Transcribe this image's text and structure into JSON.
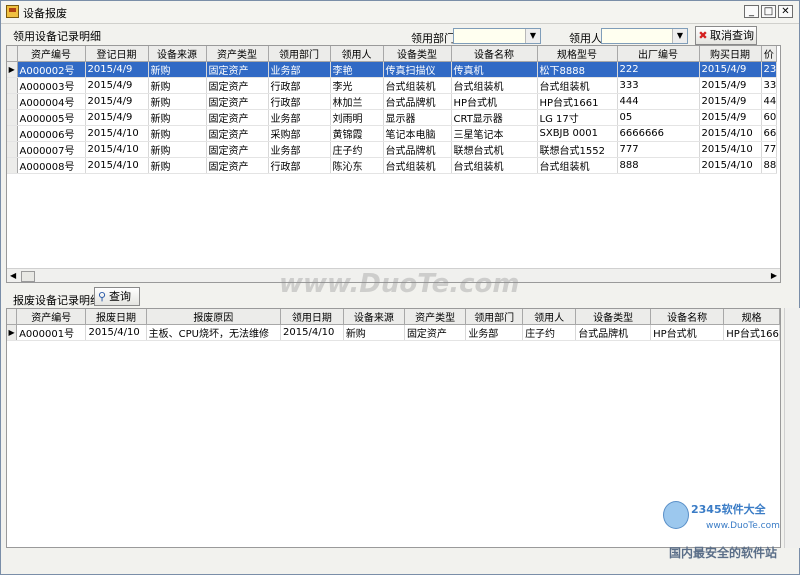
{
  "window": {
    "title": "设备报废"
  },
  "top": {
    "section_label": "领用设备记录明细",
    "dept_label": "领用部门",
    "dept_value": "",
    "user_label": "领用人",
    "user_value": "",
    "cancel_query_label": "取消查询"
  },
  "top_grid": {
    "columns": [
      "资产编号",
      "登记日期",
      "设备来源",
      "资产类型",
      "领用部门",
      "领用人",
      "设备类型",
      "设备名称",
      "规格型号",
      "出厂编号",
      "购买日期",
      "价"
    ],
    "rows": [
      [
        "A000002号",
        "2015/4/9",
        "新购",
        "固定资产",
        "业务部",
        "李艳",
        "传真扫描仪",
        "传真机",
        "松下8888",
        "222",
        "2015/4/9",
        "23"
      ],
      [
        "A000003号",
        "2015/4/9",
        "新购",
        "固定资产",
        "行政部",
        "李光",
        "台式组装机",
        "台式组装机",
        "台式组装机",
        "333",
        "2015/4/9",
        "33"
      ],
      [
        "A000004号",
        "2015/4/9",
        "新购",
        "固定资产",
        "行政部",
        "林加兰",
        "台式品牌机",
        "HP台式机",
        "HP台式1661",
        "444",
        "2015/4/9",
        "44"
      ],
      [
        "A000005号",
        "2015/4/9",
        "新购",
        "固定资产",
        "业务部",
        "刘雨明",
        "显示器",
        "CRT显示器",
        "LG 17寸",
        "05",
        "2015/4/9",
        "60"
      ],
      [
        "A000006号",
        "2015/4/10",
        "新购",
        "固定资产",
        "采购部",
        "黄锦霞",
        "笔记本电脑",
        "三星笔记本",
        "SXBJB 0001",
        "6666666",
        "2015/4/10",
        "66"
      ],
      [
        "A000007号",
        "2015/4/10",
        "新购",
        "固定资产",
        "业务部",
        "庄子约",
        "台式品牌机",
        "联想台式机",
        "联想台式1552",
        "777",
        "2015/4/10",
        "77"
      ],
      [
        "A000008号",
        "2015/4/10",
        "新购",
        "固定资产",
        "行政部",
        "陈沁东",
        "台式组装机",
        "台式组装机",
        "台式组装机",
        "888",
        "2015/4/10",
        "88"
      ]
    ]
  },
  "bottom": {
    "section_label": "报废设备记录明细",
    "query_label": "查询"
  },
  "bottom_grid": {
    "columns": [
      "资产编号",
      "报废日期",
      "报废原因",
      "领用日期",
      "设备来源",
      "资产类型",
      "领用部门",
      "领用人",
      "设备类型",
      "设备名称",
      "规格"
    ],
    "rows": [
      [
        "A000001号",
        "2015/4/10",
        "主板、CPU烧坏，无法维修",
        "2015/4/10",
        "新购",
        "固定资产",
        "业务部",
        "庄子约",
        "台式品牌机",
        "HP台式机",
        "HP台式166"
      ]
    ]
  },
  "watermarks": {
    "duote": "www.DuoTe.com",
    "site_brand": "2345软件大全",
    "site_url": "www.DuoTe.com",
    "slogan": "国内最安全的软件站"
  },
  "icons": {
    "app": "app-icon",
    "minimize": "minimize-icon",
    "maximize": "maximize-icon",
    "close": "close-icon",
    "cancel": "red-x-icon",
    "search": "magnifier-icon",
    "dropdown": "chevron-down-icon",
    "row_pointer": "row-pointer-icon"
  },
  "colors": {
    "selection": "#316ac5",
    "combo_bg": "#fffff0",
    "cancel_icon": "#d42020"
  }
}
